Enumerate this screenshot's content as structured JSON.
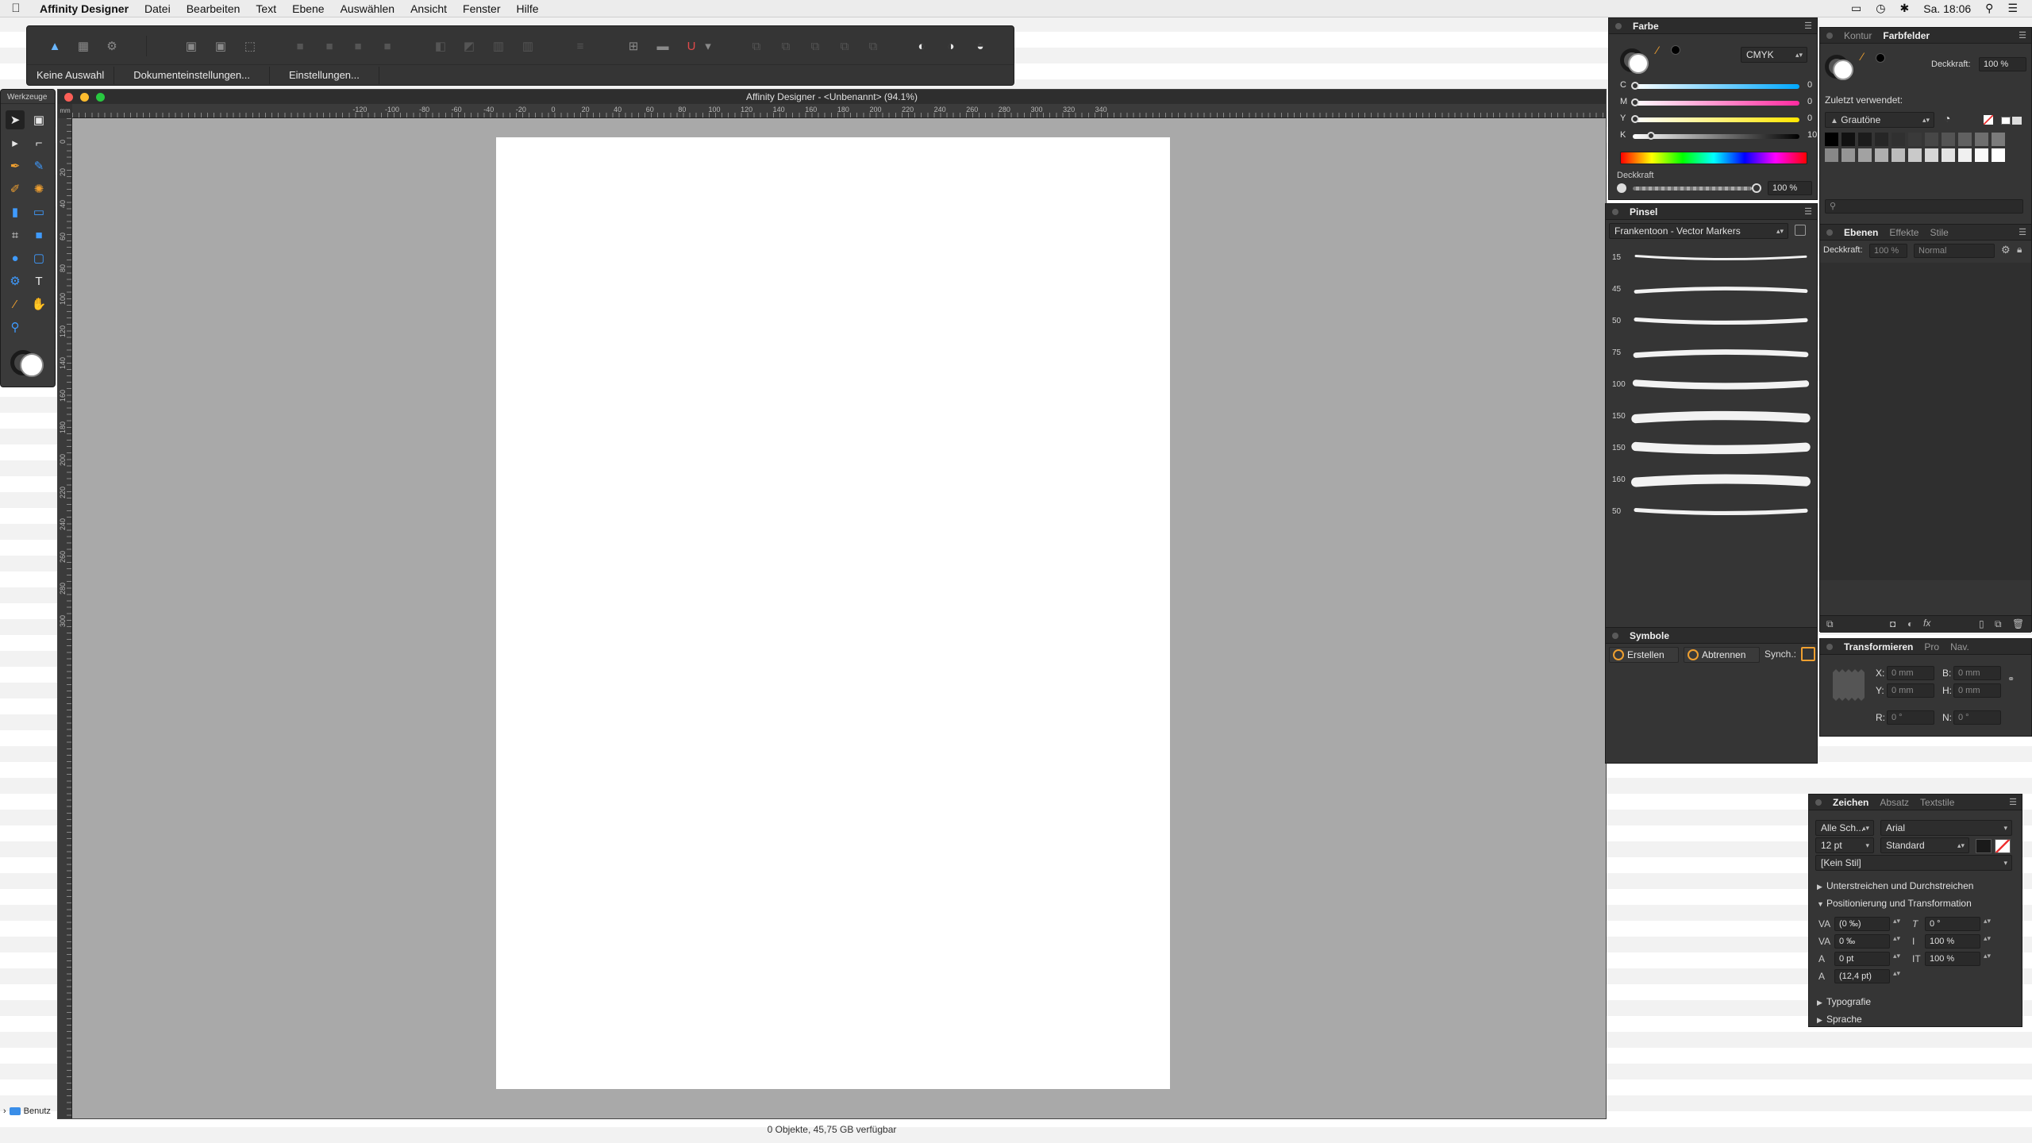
{
  "menubar": {
    "apple": "",
    "app_name": "Affinity Designer",
    "items": [
      "Datei",
      "Bearbeiten",
      "Text",
      "Ebene",
      "Auswählen",
      "Ansicht",
      "Fenster",
      "Hilfe"
    ],
    "clock": "Sa. 18:06"
  },
  "toolbar": {
    "context_buttons": [
      "Keine Auswahl",
      "Dokumenteinstellungen...",
      "Einstellungen..."
    ]
  },
  "tools": {
    "title": "Werkzeuge"
  },
  "document": {
    "title": "Affinity Designer - <Unbenannt> (94.1%)",
    "ruler_unit": "mm",
    "h_ruler_labels": [
      "-120",
      "-100",
      "-80",
      "-60",
      "-40",
      "-20",
      "0",
      "20",
      "40",
      "60",
      "80",
      "100",
      "120",
      "140",
      "160",
      "180",
      "200",
      "220",
      "240",
      "260",
      "280",
      "300",
      "320",
      "340"
    ],
    "v_ruler_labels": [
      "0",
      "20",
      "40",
      "60",
      "80",
      "100",
      "120",
      "140",
      "160",
      "180",
      "200",
      "220",
      "240",
      "260",
      "280",
      "300"
    ],
    "status": "0 Objekte, 45,75 GB verfügbar"
  },
  "finder": {
    "label": "Benutz"
  },
  "colour_panel": {
    "title": "Farbe",
    "model": "CMYK",
    "sliders": [
      {
        "label": "C",
        "value": "0",
        "gradient": "#00a8ff"
      },
      {
        "label": "M",
        "value": "0",
        "gradient": "#ff2aa0"
      },
      {
        "label": "Y",
        "value": "0",
        "gradient": "#ffe600"
      },
      {
        "label": "K",
        "value": "10",
        "gradient": "#000000"
      }
    ],
    "opacity_label": "Deckkraft",
    "opacity_value": "100 %"
  },
  "swatches_panel": {
    "tabs": [
      "Kontur",
      "Farbfelder"
    ],
    "opacity_label": "Deckkraft:",
    "opacity_value": "100 %",
    "recent_label": "Zuletzt verwendet:",
    "palette": "Grautöne",
    "greys": [
      "#000000",
      "#111111",
      "#1c1c1c",
      "#262626",
      "#303030",
      "#3a3a3a",
      "#474747",
      "#545454",
      "#616161",
      "#6e6e6e",
      "#7b7b7b",
      "#888888",
      "#959595",
      "#a2a2a2",
      "#afafaf",
      "#bcbcbc",
      "#c9c9c9",
      "#d6d6d6",
      "#e3e3e3",
      "#f0f0f0",
      "#fafafa",
      "#ffffff"
    ]
  },
  "brushes_panel": {
    "title": "Pinsel",
    "category": "Frankentoon - Vector Markers",
    "sizes": [
      "15",
      "45",
      "50",
      "75",
      "100",
      "150",
      "150",
      "160",
      "50"
    ]
  },
  "layers_panel": {
    "tabs": [
      "Ebenen",
      "Effekte",
      "Stile"
    ],
    "opacity_label": "Deckkraft:",
    "opacity_value": "100 %",
    "blend_mode": "Normal"
  },
  "symbols_panel": {
    "title": "Symbole",
    "create": "Erstellen",
    "detach": "Abtrennen",
    "sync": "Synch.:"
  },
  "transform_panel": {
    "tabs": [
      "Transformieren",
      "Pro",
      "Nav."
    ],
    "x_label": "X:",
    "x_value": "0 mm",
    "y_label": "Y:",
    "y_value": "0 mm",
    "w_label": "B:",
    "w_value": "0 mm",
    "h_label": "H:",
    "h_value": "0 mm",
    "r_label": "R:",
    "r_value": "0 °",
    "s_label": "N:",
    "s_value": "0 °"
  },
  "character_panel": {
    "tabs": [
      "Zeichen",
      "Absatz",
      "Textstile"
    ],
    "collection": "Alle Sch...",
    "font": "Arial",
    "size": "12 pt",
    "weight": "Standard",
    "style": "[Kein Stil]",
    "sections": [
      "Unterstreichen und Durchstreichen",
      "Positionierung und Transformation"
    ],
    "kerning": "(0 ‰)",
    "tracking": "0 ‰",
    "baseline": "0 pt",
    "leading": "(12,4 pt)",
    "shear": "0 °",
    "vscale": "100 %",
    "hscale": "100 %",
    "footer_sections": [
      "Typografie",
      "Sprache"
    ]
  }
}
